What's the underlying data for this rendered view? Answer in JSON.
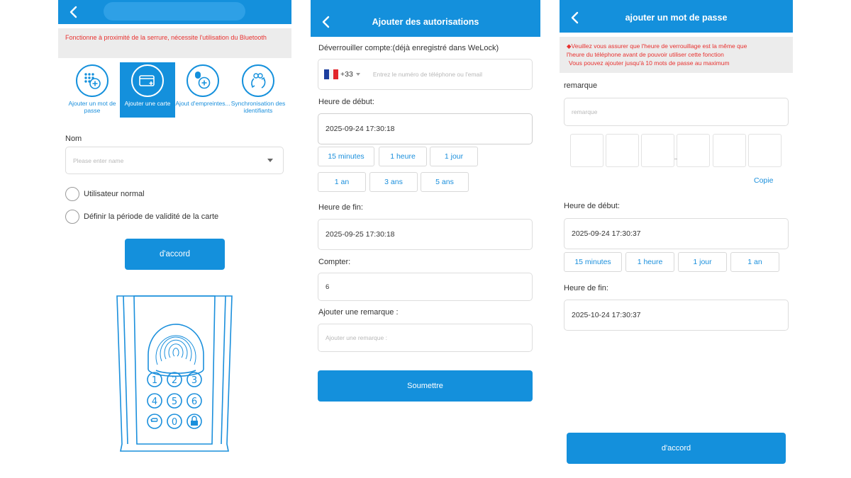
{
  "panel1": {
    "warning": "Fonctionne à proximité de la serrure, nécessite l'utilisation du Bluetooth",
    "tabs": [
      {
        "label": "Ajouter un mot de passe"
      },
      {
        "label": "Ajouter une carte"
      },
      {
        "label": "Ajout d'empreintes..."
      },
      {
        "label": "Synchronisation des identifiants"
      }
    ],
    "name_label": "Nom",
    "name_placeholder": "Please enter name",
    "radio_normal": "Utilisateur normal",
    "radio_period": "Définir la période de validité de la carte",
    "ok_button": "d'accord",
    "keypad": [
      "1",
      "2",
      "3",
      "4",
      "5",
      "6",
      "↩",
      "0",
      "🔒"
    ]
  },
  "panel2": {
    "title": "Ajouter des autorisations",
    "account_label": "Déverrouiller compte:(déjà enregistré dans WeLock)",
    "country_code": "+33",
    "phone_placeholder": "Entrez le numéro de téléphone ou l'email",
    "start_label": "Heure de début:",
    "start_value": "2025-09-24 17:30:18",
    "durations": [
      "15 minutes",
      "1 heure",
      "1 jour",
      "1 an",
      "3 ans",
      "5 ans"
    ],
    "end_label": "Heure de fin:",
    "end_value": "2025-09-25 17:30:18",
    "count_label": "Compter:",
    "count_value": "6",
    "remark_label": "Ajouter une remarque :",
    "remark_placeholder": "Ajouter une remarque :",
    "submit_button": "Soumettre"
  },
  "panel3": {
    "title": "ajouter un mot de passe",
    "warning_lines": [
      "◆Veuillez vous assurer que l'heure de verrouillage est la même que",
      "l'heure du téléphone avant de pouvoir utiliser cette fonction",
      "Vous pouvez ajouter jusqu'à 10 mots de passe au maximum"
    ],
    "remark_label": "remarque",
    "remark_placeholder": "remarque",
    "copy_link": "Copie",
    "start_label": "Heure de début:",
    "start_value": "2025-09-24 17:30:37",
    "durations": [
      "15 minutes",
      "1 heure",
      "1 jour",
      "1 an"
    ],
    "end_label": "Heure de fin:",
    "end_value": "2025-10-24 17:30:37",
    "ok_button": "d'accord"
  },
  "colors": {
    "primary": "#1490dc",
    "warning_text": "#e8312f",
    "warning_bg": "#ececec"
  }
}
